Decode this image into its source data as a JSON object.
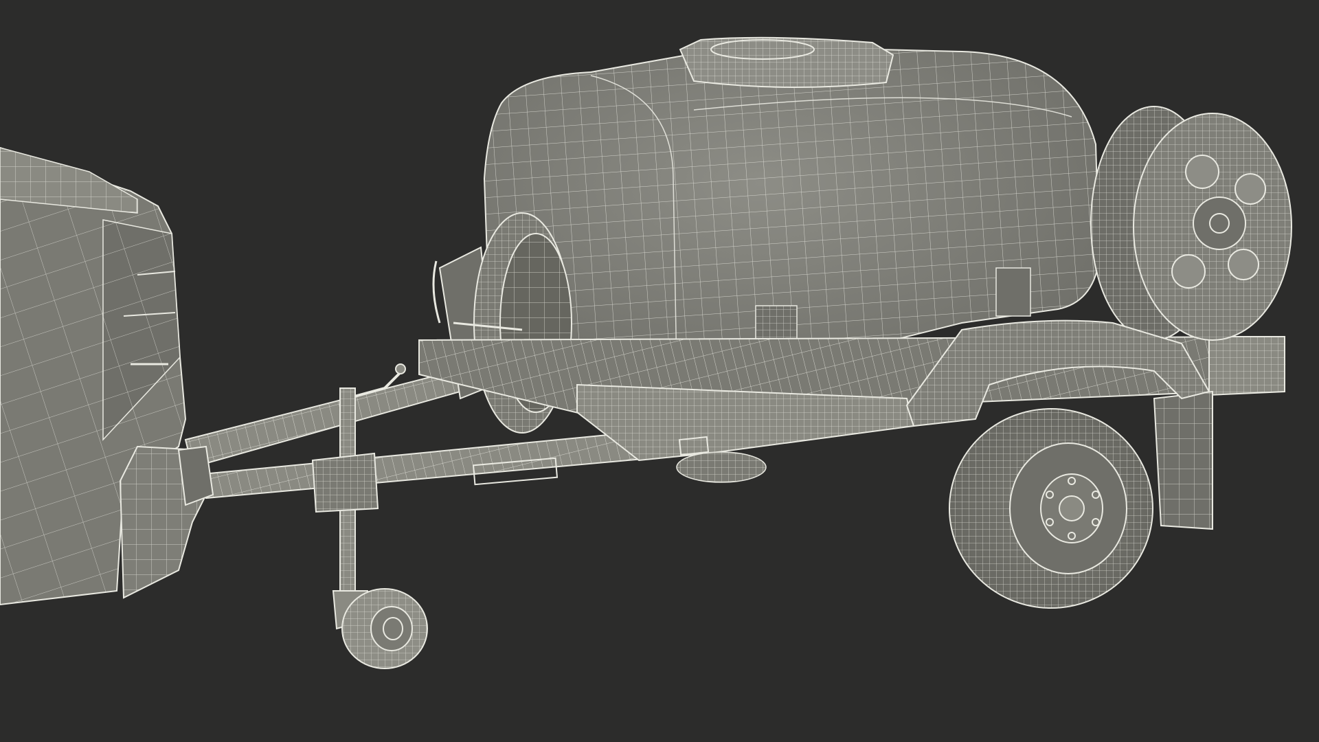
{
  "scene": {
    "background_color": "#2c2c2b",
    "mesh_fill": "#7c7c75",
    "mesh_fill_light": "#8a8a82",
    "mesh_dark": "#4a4a45",
    "wire_color": "#e9e9e1"
  }
}
